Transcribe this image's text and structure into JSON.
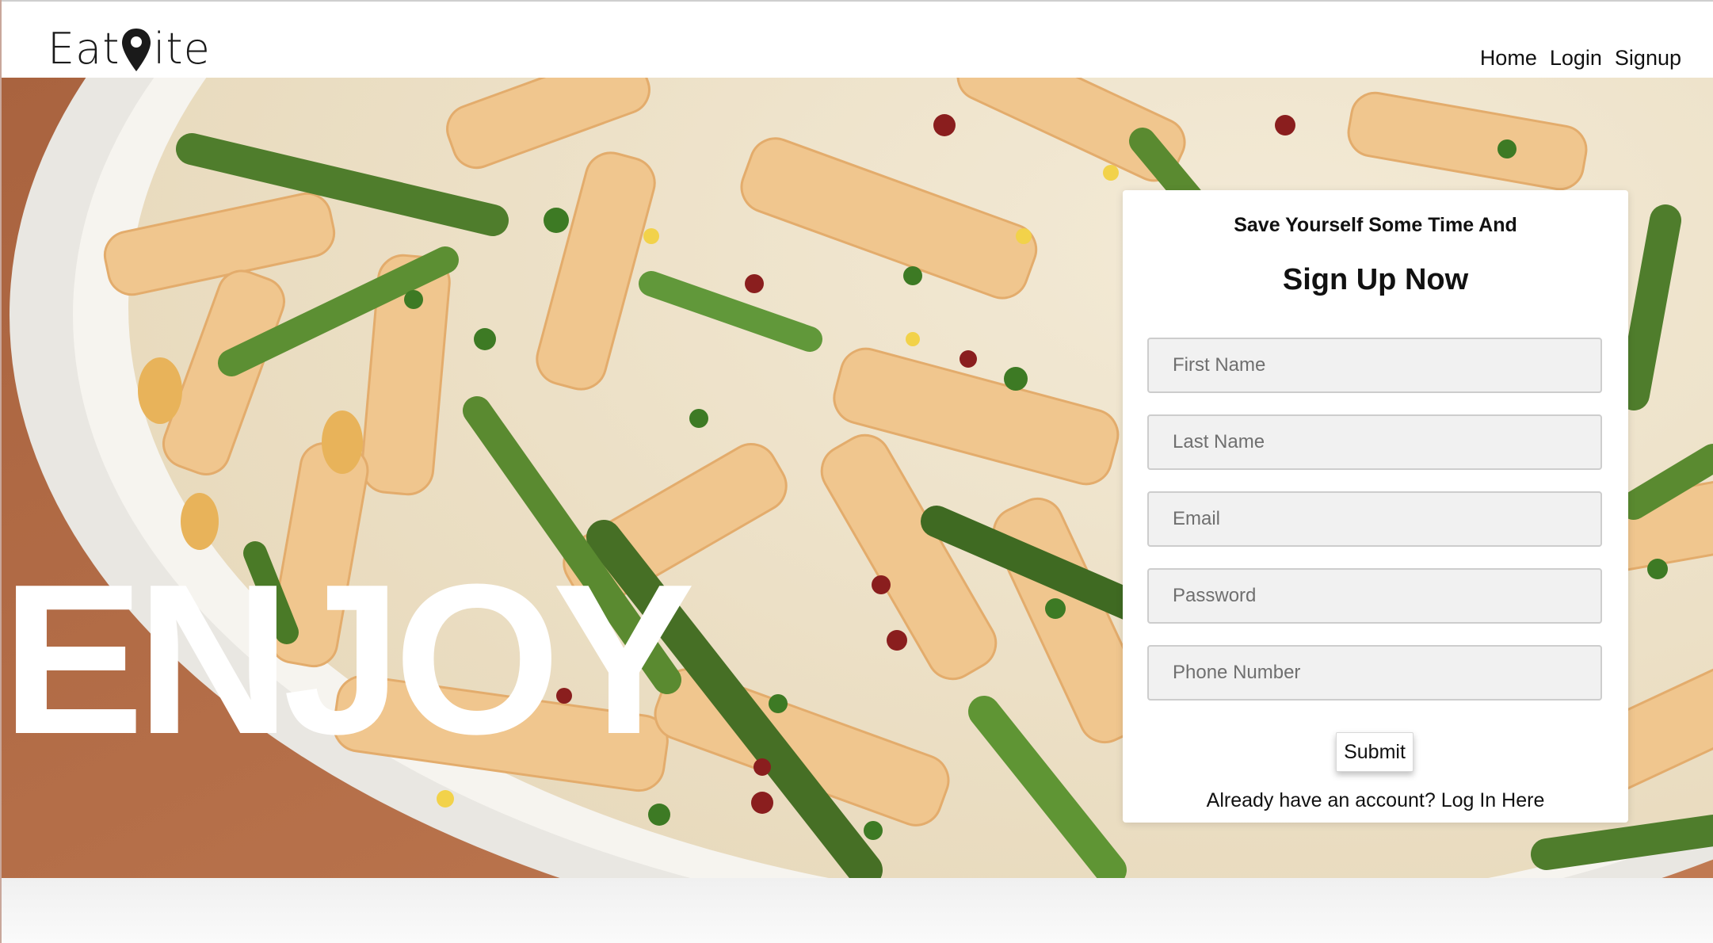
{
  "brand": {
    "logo_before": "Eat",
    "logo_after": "ite",
    "logo_icon": "map-pin-icon"
  },
  "nav": {
    "home": "Home",
    "login": "Login",
    "signup": "Signup"
  },
  "hero": {
    "headline": "ENJOY",
    "image": "pasta-with-asparagus-photo"
  },
  "signup_form": {
    "subtitle": "Save Yourself Some Time And",
    "title": "Sign Up Now",
    "first_name_placeholder": "First Name",
    "last_name_placeholder": "Last Name",
    "email_placeholder": "Email",
    "password_placeholder": "Password",
    "phone_placeholder": "Phone Number",
    "submit_label": "Submit",
    "login_prompt": "Already have an account?",
    "login_link": "Log In Here"
  },
  "colors": {
    "accent": "#111111",
    "card_bg": "#ffffff",
    "field_bg": "#f1f1f1",
    "table_wood": "#b06e4a"
  }
}
